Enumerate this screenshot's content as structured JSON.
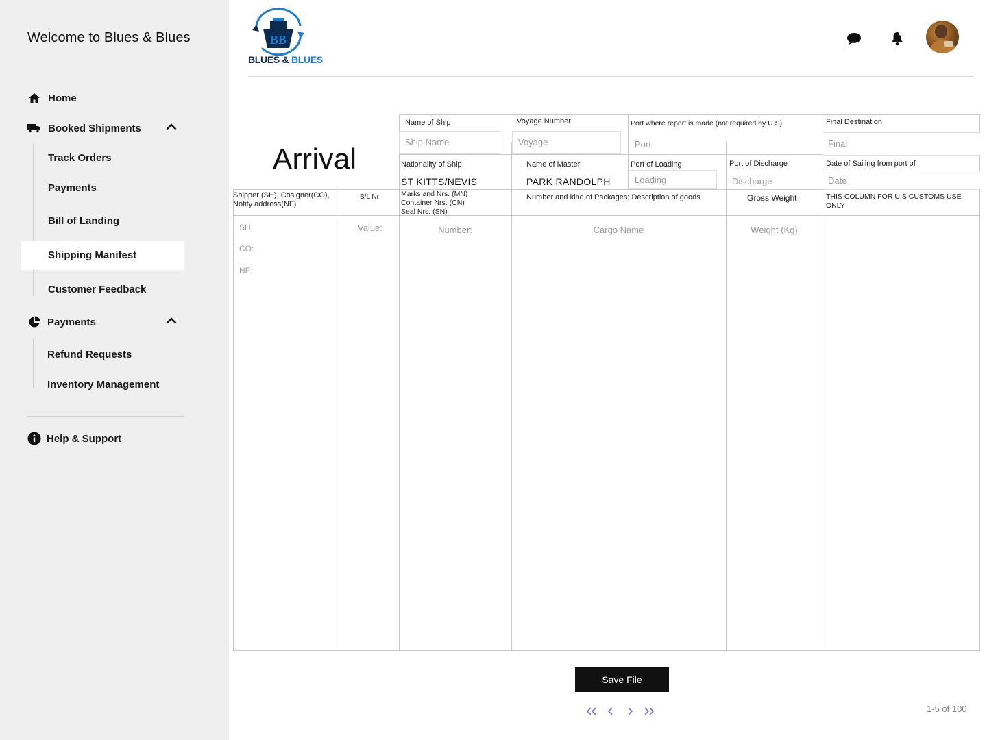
{
  "sidebar": {
    "welcome": "Welcome to Blues & Blues",
    "home": "Home",
    "booked_shipments": "Booked Shipments",
    "booked_sub": [
      "Track Orders",
      "Payments",
      "Bill of Landing",
      "Shipping Manifest",
      "Customer Feedback"
    ],
    "payments": "Payments",
    "payments_sub": [
      "Refund Requests",
      "Inventory Management"
    ],
    "help": "Help & Support",
    "active_item": "Shipping Manifest"
  },
  "header": {
    "logo_part1": "BLUES & ",
    "logo_part2": "BLUES",
    "icons": [
      "chat-icon",
      "bell-icon",
      "avatar"
    ]
  },
  "form": {
    "title": "Arrival",
    "name_of_ship_label": "Name of Ship",
    "name_of_ship_placeholder": "Ship Name",
    "voyage_label": "Voyage Number",
    "voyage_placeholder": "Voyage",
    "port_report_label": "Port where report is made (not required by U.S)",
    "port_report_placeholder": "Port",
    "final_dest_label": "Final Destination",
    "final_dest_placeholder": "Final",
    "nationality_label": "Nationality of Ship",
    "nationality_value": "ST KITTS/NEVIS",
    "master_label": "Name of Master",
    "master_value": "PARK RANDOLPH",
    "port_loading_label": "Port of Loading",
    "port_loading_placeholder": "Loading",
    "port_discharge_label": "Port of Discharge",
    "port_discharge_placeholder": "Discharge",
    "sailing_date_label": "Date of Sailing from port of",
    "sailing_date_placeholder": "Date"
  },
  "table": {
    "col_shipper": "Shipper (SH), Cosigner(CO), Notify address(NF)",
    "col_bl": "B/L Nr",
    "col_marks_1": "Marks and Nrs. (MN)",
    "col_marks_2": "Container Nrs. (CN)",
    "col_marks_3": "Seal Nrs. (SN)",
    "col_packages": "Number and kind of Packages; Description of goods",
    "col_weight": "Gross Weight",
    "col_customs": "THIS COLUMN FOR U.S CUSTOMS USE ONLY",
    "ph_sh": "SH:",
    "ph_co": "CO:",
    "ph_nf": "NF:",
    "ph_value": "Value:",
    "ph_number": "Number:",
    "ph_cargo": "Cargo Name",
    "ph_weight": "Weight (Kg)"
  },
  "actions": {
    "save": "Save File",
    "page_count": "1-5 of 100"
  },
  "colors": {
    "sidebar_bg": "#efefef",
    "accent_pager": "#7b6fd6",
    "button_bg": "#111111"
  }
}
